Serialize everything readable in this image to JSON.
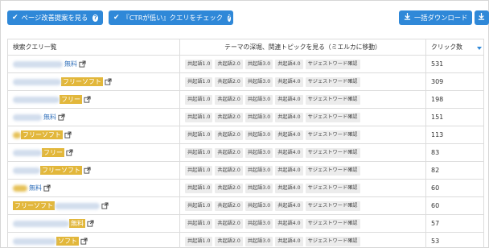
{
  "toolbar": {
    "page_improve_label": "ページ改善提案を見る",
    "ctr_low_label": "『CTRが低い』クエリをチェック",
    "bulk_download_label": "一括ダウンロード"
  },
  "table": {
    "headers": {
      "query": "検索クエリ一覧",
      "topics": "テーマの深堀、関連トピックを見る（ミエルカに移動）",
      "clicks": "クリック数"
    },
    "tag_labels": [
      "共起語1.0",
      "共起語2.0",
      "共起語3.0",
      "共起語4.0",
      "サジェストワード確認"
    ],
    "rows": [
      {
        "highlight": "",
        "link_text": "無料",
        "clicks": "531"
      },
      {
        "highlight": "フリーソフト",
        "link_text": "",
        "clicks": "309"
      },
      {
        "highlight": "フリー",
        "link_text": "",
        "clicks": "198"
      },
      {
        "highlight": "",
        "link_text": "無料",
        "clicks": "151"
      },
      {
        "highlight": "フリーソフト",
        "link_text": "",
        "clicks": "113"
      },
      {
        "highlight": "フリー",
        "link_text": "",
        "clicks": "83"
      },
      {
        "highlight": "フリーソフト",
        "link_text": "",
        "clicks": "82"
      },
      {
        "highlight": "",
        "link_text": "無料",
        "clicks": "60"
      },
      {
        "highlight": "フリーソフト",
        "link_text": "",
        "clicks": "60"
      },
      {
        "highlight": "無料",
        "link_text": "",
        "clicks": "57"
      },
      {
        "highlight": "ソフト",
        "link_text": "",
        "clicks": "53"
      }
    ]
  },
  "colors": {
    "accent": "#2f88d8",
    "highlight": "#e2b73b",
    "tag_bg": "#ececec"
  }
}
